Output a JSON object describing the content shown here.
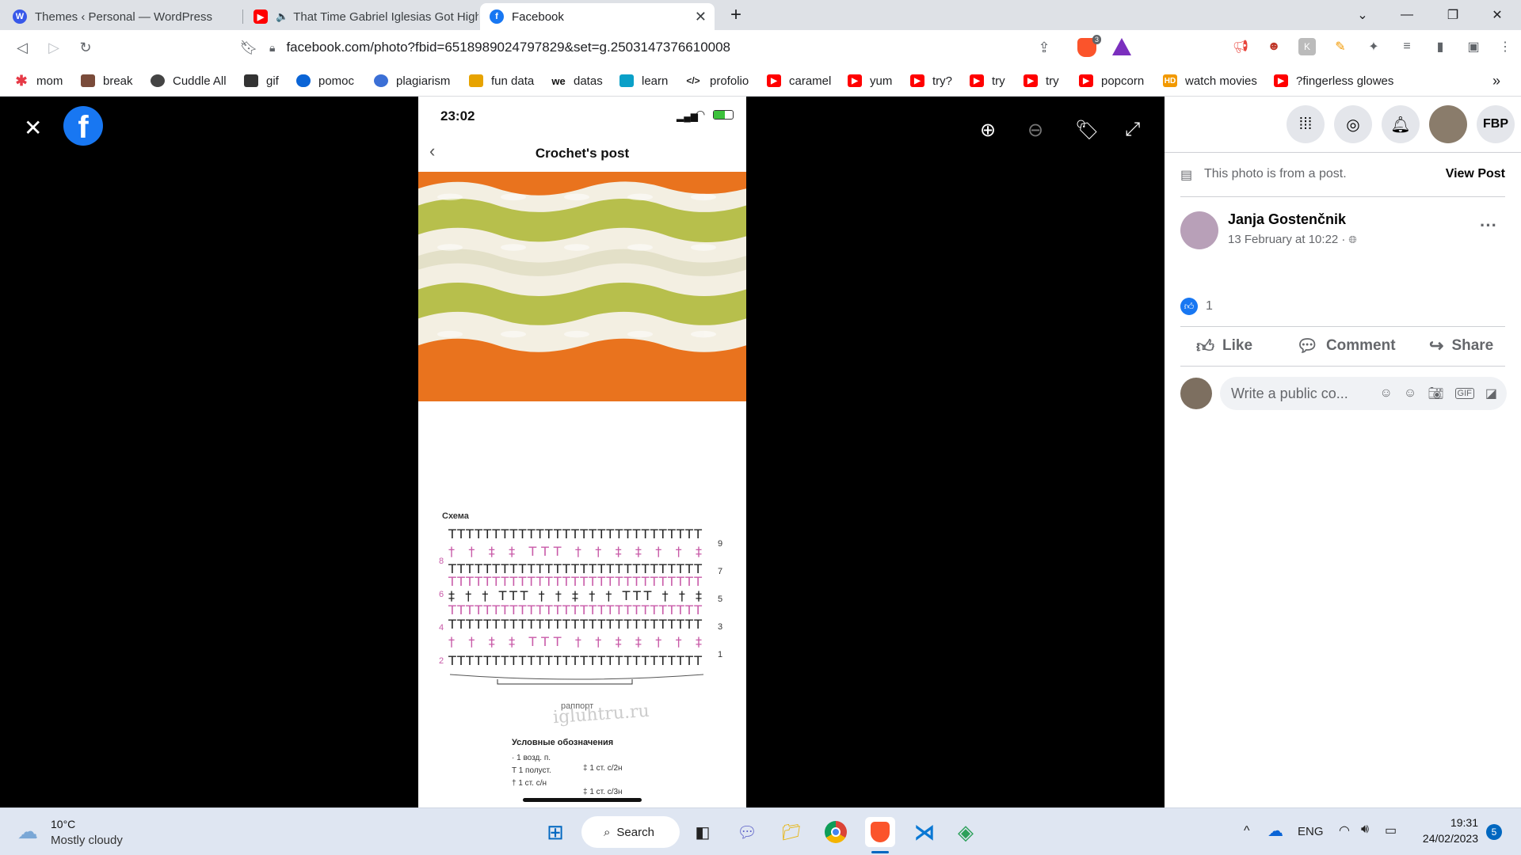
{
  "browser": {
    "tabs": [
      {
        "title": "Themes ‹ Personal — WordPress",
        "icon": "wordpress-icon"
      },
      {
        "title": "That Time Gabriel Iglesias Got High",
        "icon": "youtube-icon",
        "audio": true
      },
      {
        "title": "Facebook",
        "icon": "facebook-icon",
        "active": true
      }
    ],
    "new_tab": "+",
    "url": "facebook.com/photo?fbid=651898902479782​9&set=g.2503147376610008",
    "url_display": "facebook.com/photo?fbid=6518989024797829&set=g.2503147376610008",
    "shield_badge": "3",
    "bookmarks": [
      {
        "label": "mom",
        "icon": "star-burst-icon",
        "color": "#e63946"
      },
      {
        "label": "break",
        "icon": "avatar-icon",
        "color": "#7a4b3a"
      },
      {
        "label": "Cuddle All",
        "icon": "globe-icon",
        "color": "#444"
      },
      {
        "label": "gif",
        "icon": "image-icon",
        "color": "#333"
      },
      {
        "label": "pomoc",
        "icon": "onedrive-icon",
        "color": "#0a64d6"
      },
      {
        "label": "plagiarism",
        "icon": "eye-icon",
        "color": "#3b6fd6"
      },
      {
        "label": "fun data",
        "icon": "chart-icon",
        "color": "#e7a300"
      },
      {
        "label": "datas",
        "icon": "we-icon",
        "color": "#111"
      },
      {
        "label": "learn",
        "icon": "code-icon",
        "color": "#0aa0c8"
      },
      {
        "label": "profolio",
        "icon": "brackets-icon",
        "color": "#222"
      },
      {
        "label": "caramel",
        "icon": "youtube-icon",
        "color": "#ff0000"
      },
      {
        "label": "yum",
        "icon": "youtube-icon",
        "color": "#ff0000"
      },
      {
        "label": "try?",
        "icon": "youtube-icon",
        "color": "#ff0000"
      },
      {
        "label": "try",
        "icon": "youtube-icon",
        "color": "#ff0000"
      },
      {
        "label": "try",
        "icon": "youtube-icon",
        "color": "#ff0000"
      },
      {
        "label": "popcorn",
        "icon": "youtube-icon",
        "color": "#ff0000"
      },
      {
        "label": "watch movies",
        "icon": "hd-icon",
        "color": "#f29900"
      },
      {
        "label": "?fingerless glowes",
        "icon": "youtube-icon",
        "color": "#ff0000"
      }
    ],
    "more_bookmarks": "»"
  },
  "phone": {
    "time": "23:02",
    "header_title": "Crochet's post",
    "chart_title": "Схема",
    "row_numbers_right": [
      "9",
      "7",
      "5",
      "3",
      "1"
    ],
    "row_numbers_left": [
      "8",
      "6",
      "4",
      "2"
    ],
    "repeat_label": "раппорт",
    "watermark": "igluhtru.ru",
    "legend_title": "Условные обозначения",
    "legend_items": [
      "1 возд. п.",
      "1 полуст.",
      "1 ст. с/н",
      "1 ст. с/2н",
      "1 ст. с/3н"
    ]
  },
  "sidebar": {
    "from_post_text": "This photo is from a post.",
    "view_post": "View Post",
    "author": "Janja Gostenčnik",
    "date": "13 February at 10:22 ·",
    "like_count": "1",
    "actions": {
      "like": "Like",
      "comment": "Comment",
      "share": "Share"
    },
    "comment_placeholder": "Write a public co...",
    "profile_label": "FBP"
  },
  "taskbar": {
    "weather_temp": "10°C",
    "weather_desc": "Mostly cloudy",
    "search_label": "Search",
    "language": "ENG",
    "time": "19:31",
    "date": "24/02/2023",
    "notifications": "5"
  },
  "colors": {
    "facebook_blue": "#1877f2",
    "orange_yarn": "#e9731e",
    "green_yarn": "#b7bf4c",
    "cream_yarn": "#f3efe2",
    "pink_symbol": "#c85aa8"
  }
}
